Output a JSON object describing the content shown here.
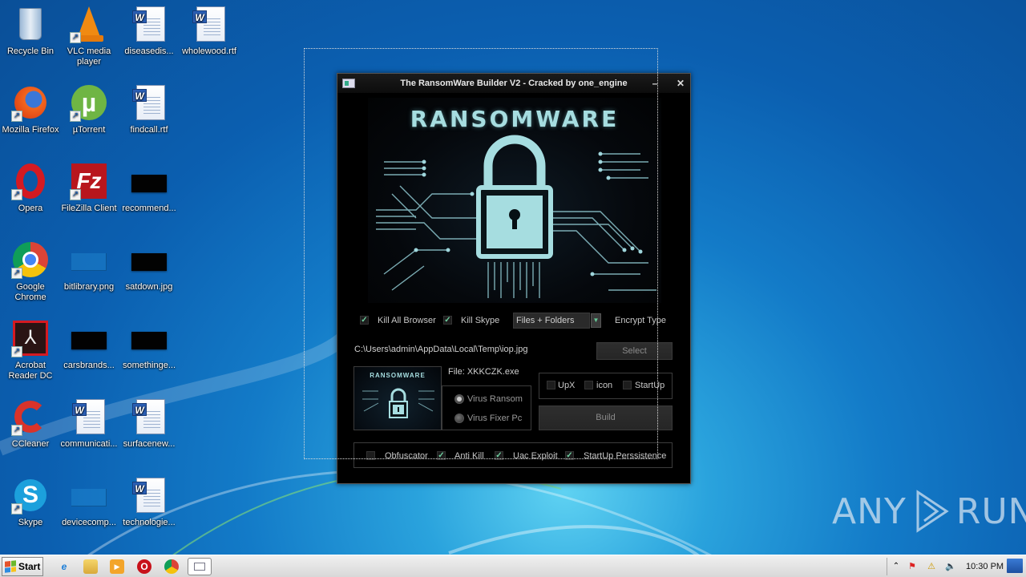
{
  "desktop": {
    "icons": [
      {
        "label": "Recycle Bin",
        "icon": "recycle-bin-icon"
      },
      {
        "label": "VLC media player",
        "icon": "vlc-icon"
      },
      {
        "label": "diseasedis...",
        "icon": "word-doc-icon"
      },
      {
        "label": "wholewood.rtf",
        "icon": "word-doc-icon"
      },
      {
        "label": "Mozilla Firefox",
        "icon": "firefox-icon"
      },
      {
        "label": "µTorrent",
        "icon": "utorrent-icon"
      },
      {
        "label": "findcall.rtf",
        "icon": "word-doc-icon"
      },
      {
        "label": "Opera",
        "icon": "opera-icon"
      },
      {
        "label": "FileZilla Client",
        "icon": "filezilla-icon"
      },
      {
        "label": "recommend...",
        "icon": "image-thumbnail-icon"
      },
      {
        "label": "Google Chrome",
        "icon": "chrome-icon"
      },
      {
        "label": "bitlibrary.png",
        "icon": "image-thumbnail-icon"
      },
      {
        "label": "satdown.jpg",
        "icon": "image-thumbnail-icon"
      },
      {
        "label": "Acrobat Reader DC",
        "icon": "acrobat-icon"
      },
      {
        "label": "carsbrands...",
        "icon": "image-thumbnail-icon"
      },
      {
        "label": "somethinge...",
        "icon": "image-thumbnail-icon"
      },
      {
        "label": "CCleaner",
        "icon": "ccleaner-icon"
      },
      {
        "label": "communicati...",
        "icon": "word-doc-icon"
      },
      {
        "label": "surfacenew...",
        "icon": "word-doc-icon"
      },
      {
        "label": "Skype",
        "icon": "skype-icon"
      },
      {
        "label": "devicecomp...",
        "icon": "image-thumbnail-icon"
      },
      {
        "label": "technologie...",
        "icon": "word-doc-icon"
      }
    ]
  },
  "window": {
    "title": "The RansomWare Builder V2 - Cracked by one_engine",
    "minimize_glyph": "–",
    "close_glyph": "✕",
    "banner_title": "RANSOMWARE",
    "thumb_title": "RANSOMWARE",
    "kill_all_browser": {
      "label": "Kill All Browser",
      "checked": true
    },
    "kill_skype": {
      "label": "Kill Skype",
      "checked": true
    },
    "encrypt_type": {
      "selected": "Files + Folders",
      "label": "Encrypt Type"
    },
    "image_path": "C:\\Users\\admin\\AppData\\Local\\Temp\\iop.jpg",
    "select_button": "Select",
    "file_label": "File: XKKCZK.exe",
    "mode": {
      "options": [
        {
          "label": "Virus Ransom",
          "selected": true
        },
        {
          "label": "Virus Fixer Pc",
          "selected": false
        }
      ]
    },
    "options_top": [
      {
        "label": "UpX",
        "checked": false
      },
      {
        "label": "icon",
        "checked": false
      },
      {
        "label": "StartUp",
        "checked": false
      }
    ],
    "build_button": "Build",
    "options_bottom": [
      {
        "label": "Obfuscator",
        "checked": false
      },
      {
        "label": "Anti Kill",
        "checked": true
      },
      {
        "label": "Uac Exploit",
        "checked": true
      },
      {
        "label": "StartUp Perssistence",
        "checked": true
      }
    ],
    "check_glyph": "✓"
  },
  "taskbar": {
    "start_label": "Start",
    "pinned": [
      "internet-explorer-icon",
      "explorer-icon",
      "media-player-icon",
      "opera-icon",
      "chrome-icon",
      "ransomware-builder-icon"
    ],
    "clock": "10:30 PM"
  },
  "watermark": {
    "left": "ANY",
    "right": "RUN"
  }
}
